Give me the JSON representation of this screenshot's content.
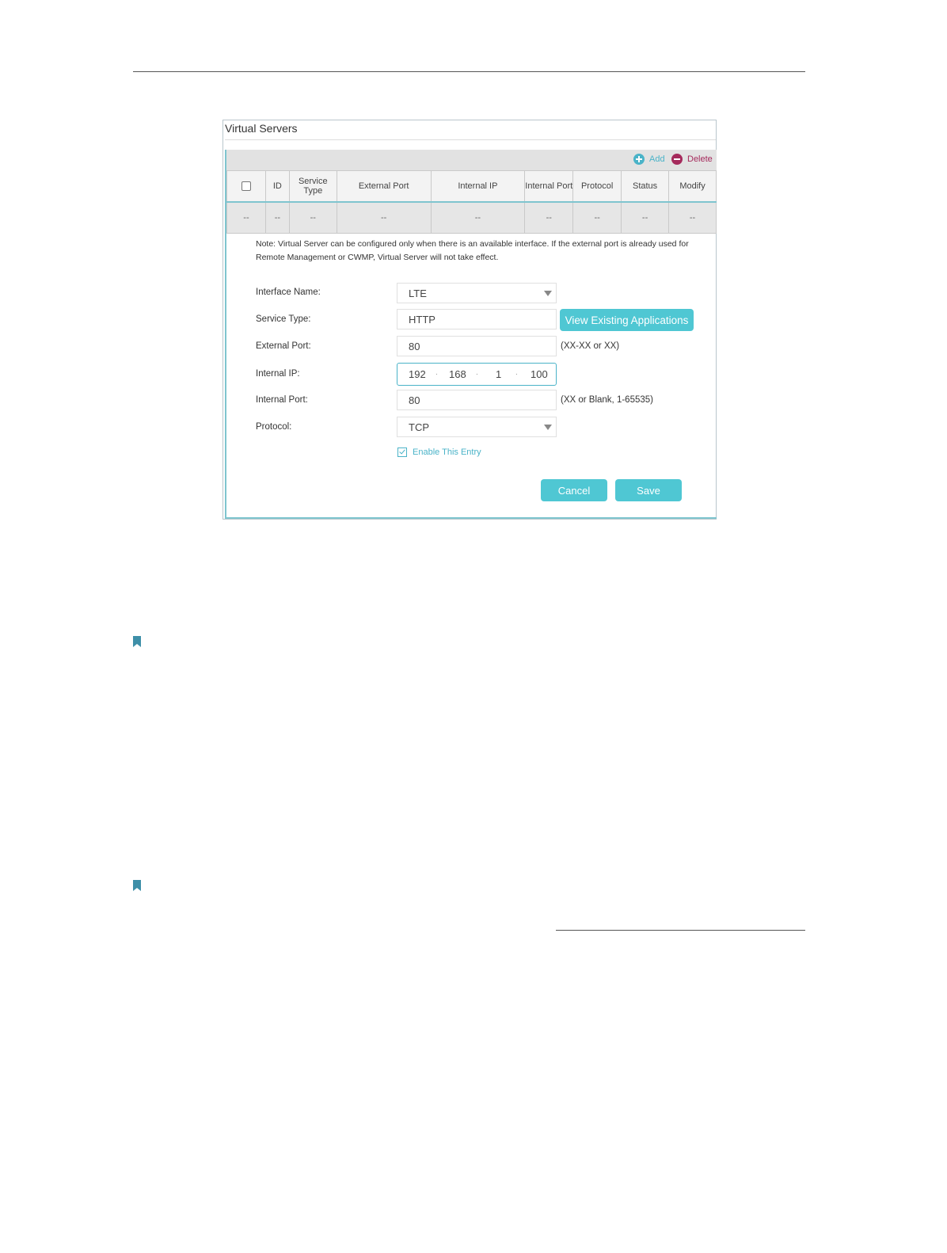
{
  "panel": {
    "title": "Virtual Servers",
    "toolbar": {
      "add_label": "Add",
      "delete_label": "Delete",
      "add_icon": "plus-circle-icon",
      "delete_icon": "minus-circle-icon"
    },
    "table": {
      "headers": [
        "ID",
        "Service Type",
        "External Port",
        "Internal IP",
        "Internal Port",
        "Protocol",
        "Status",
        "Modify"
      ],
      "empty_row": [
        "--",
        "--",
        "--",
        "--",
        "--",
        "--",
        "--",
        "--",
        "--"
      ]
    },
    "note": "Note: Virtual Server can be configured only when there is an available interface. If the external port is already used for Remote Management or CWMP, Virtual Server will not take effect.",
    "form": {
      "interface_name": {
        "label": "Interface Name:",
        "value": "LTE"
      },
      "service_type": {
        "label": "Service Type:",
        "value": "HTTP",
        "button": "View Existing Applications"
      },
      "external_port": {
        "label": "External Port:",
        "value": "80",
        "hint": "(XX-XX or XX)"
      },
      "internal_ip": {
        "label": "Internal IP:",
        "octets": [
          "192",
          "168",
          "1",
          "100"
        ],
        "separator": "."
      },
      "internal_port": {
        "label": "Internal Port:",
        "value": "80",
        "hint": "(XX or Blank, 1-65535)"
      },
      "protocol": {
        "label": "Protocol:",
        "value": "TCP"
      },
      "enable_entry": {
        "label": "Enable This Entry",
        "checked": true
      }
    },
    "buttons": {
      "cancel": "Cancel",
      "save": "Save"
    }
  },
  "colors": {
    "accent": "#4fc7d3",
    "delete": "#a52a5c",
    "bookmark": "#3e8fa8"
  }
}
